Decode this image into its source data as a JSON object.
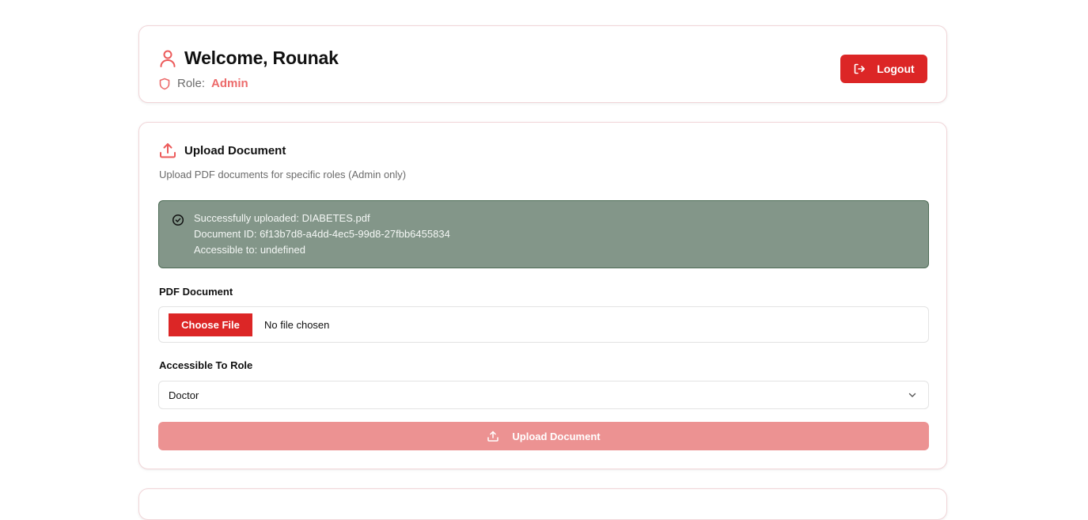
{
  "header": {
    "welcome_title": "Welcome, Rounak",
    "role_label": "Role:",
    "role_value": "Admin",
    "logout_label": "Logout"
  },
  "upload": {
    "title": "Upload Document",
    "description": "Upload PDF documents for specific roles (Admin only)",
    "alert": {
      "line1": "Successfully uploaded: DIABETES.pdf",
      "line2": "Document ID: 6f13b7d8-a4dd-4ec5-99d8-27fbb6455834",
      "line3": "Accessible to: undefined"
    },
    "pdf_label": "PDF Document",
    "choose_file_label": "Choose File",
    "file_status": "No file chosen",
    "role_field_label": "Accessible To Role",
    "role_selected": "Doctor",
    "submit_label": "Upload Document"
  },
  "icons": {
    "user": "user-icon",
    "shield": "shield-icon",
    "logout": "logout-icon",
    "upload": "upload-icon",
    "success": "check-circle-icon",
    "chevron": "chevron-down-icon"
  },
  "colors": {
    "accent": "#dc2626",
    "accent_light": "#ec6a6a",
    "disabled_button": "#ec9292",
    "success_bg": "#839689",
    "success_border": "#4d6b55"
  }
}
